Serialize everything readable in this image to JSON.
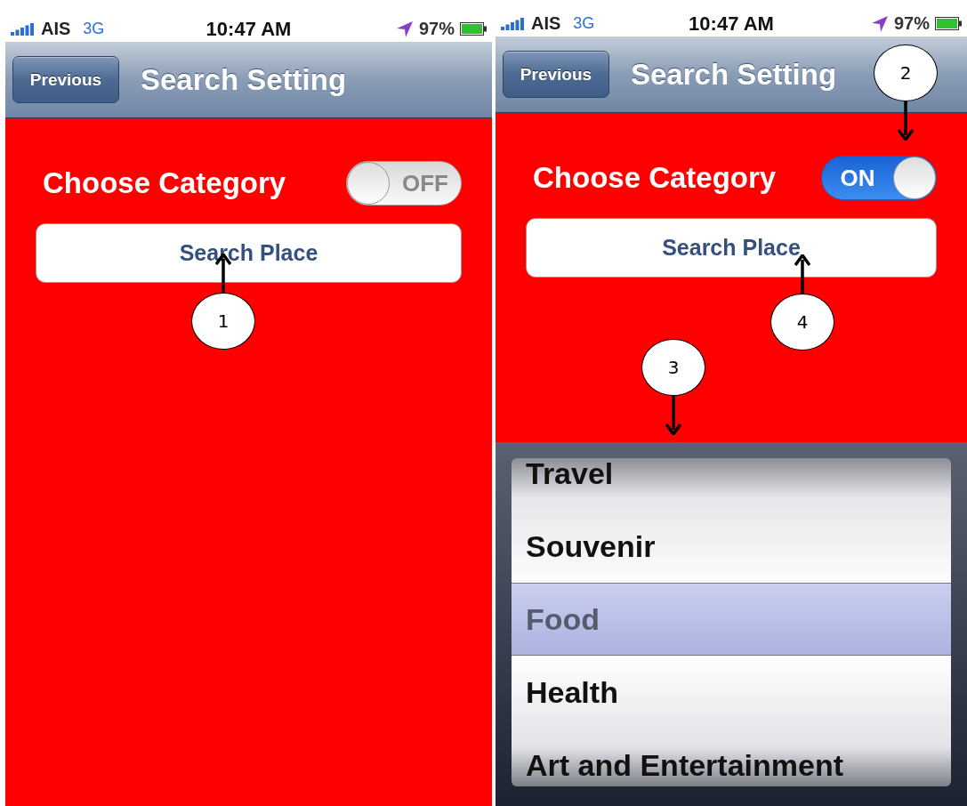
{
  "phones": [
    {
      "status_bar": {
        "carrier": "AIS",
        "network": "3G",
        "time": "10:47 AM",
        "battery": "97%"
      },
      "nav": {
        "back_button": "Previous",
        "title": "Search Setting"
      },
      "category_label": "Choose Category",
      "toggle": {
        "on": false,
        "label": "OFF"
      },
      "search_button": "Search Place",
      "callouts": [
        {
          "label": "1",
          "kind": "up"
        }
      ]
    },
    {
      "status_bar": {
        "carrier": "AIS",
        "network": "3G",
        "time": "10:47 AM",
        "battery": "97%"
      },
      "nav": {
        "back_button": "Previous",
        "title": "Search Setting"
      },
      "category_label": "Choose Category",
      "toggle": {
        "on": true,
        "label": "ON"
      },
      "search_button": "Search Place",
      "picker": {
        "items": [
          {
            "label": "Travel",
            "selected": false
          },
          {
            "label": "Souvenir",
            "selected": false
          },
          {
            "label": "Food",
            "selected": true
          },
          {
            "label": "Health",
            "selected": false
          },
          {
            "label": "Art and Entertainment",
            "selected": false
          }
        ]
      },
      "callouts": [
        {
          "label": "2",
          "kind": "down"
        },
        {
          "label": "4",
          "kind": "up"
        },
        {
          "label": "3",
          "kind": "down"
        }
      ]
    }
  ]
}
